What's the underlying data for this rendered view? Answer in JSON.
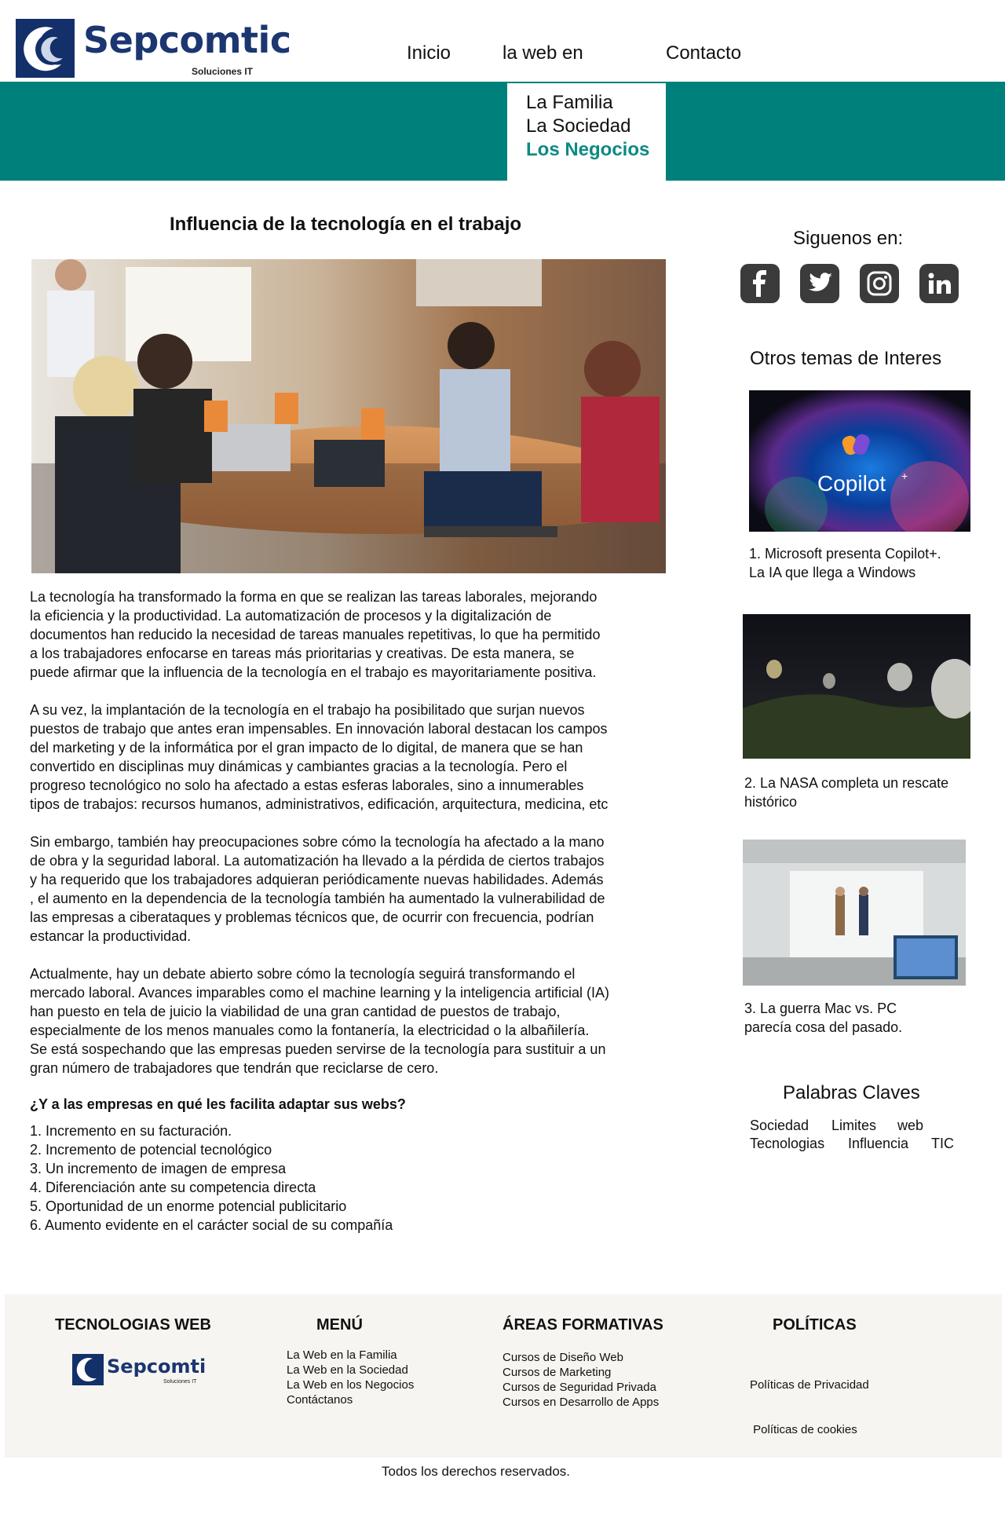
{
  "brand": {
    "name": "Sepcomtic",
    "tagline": "Soluciones IT"
  },
  "nav": {
    "inicio": "Inicio",
    "web": "la web en",
    "contacto": "Contacto"
  },
  "dropdown": [
    "La Familia",
    "La Sociedad",
    "Los Negocios"
  ],
  "article": {
    "title": "Influencia de la tecnología en el trabajo",
    "paragraphs": [
      "La tecnología ha transformado la forma en que se realizan las tareas laborales, mejorando\n la eficiencia y la productividad. La automatización de procesos y la digitalización de\ndocumentos han reducido la necesidad de tareas manuales repetitivas, lo que ha permitido\na los trabajadores enfocarse en tareas más prioritarias y creativas. De esta manera, se\npuede afirmar que la influencia de la tecnología en el trabajo es mayoritariamente positiva.",
      "A su vez, la implantación de la tecnología en el trabajo ha posibilitado que surjan nuevos\npuestos de trabajo que antes eran impensables. En innovación laboral destacan los campos\n del marketing y de la informática por el gran impacto de lo digital, de manera que se han\nconvertido en disciplinas muy dinámicas y cambiantes gracias a la tecnología. Pero el\n progreso tecnológico no solo ha afectado a estas esferas laborales, sino a innumerables\n tipos de trabajos: recursos humanos, administrativos, edificación, arquitectura, medicina, etc",
      "Sin embargo, también hay preocupaciones sobre cómo la tecnología ha afectado a la mano\nde obra y la seguridad laboral. La automatización ha llevado a la pérdida de ciertos trabajos\n y ha requerido que los trabajadores adquieran periódicamente nuevas habilidades. Además\n, el aumento en la dependencia de la tecnología también ha aumentado la vulnerabilidad de\n las empresas a ciberataques y problemas técnicos que, de ocurrir con frecuencia, podrían\nestancar la productividad.",
      "Actualmente, hay un debate abierto sobre cómo la tecnología seguirá transformando el\nmercado laboral. Avances imparables como el machine learning y la inteligencia artificial (IA)\n han puesto en tela de juicio la viabilidad de una gran cantidad de puestos de trabajo,\nespecialmente de los menos manuales como la fontanería, la electricidad o la albañilería.\nSe está sospechando que las empresas pueden servirse de la tecnología para sustituir a un\n gran número de trabajadores que tendrán que reciclarse de cero."
    ],
    "question": "¿Y a las empresas en qué les facilita adaptar sus webs?",
    "benefits": [
      "1. Incremento en su facturación.",
      "2. Incremento de potencial tecnológico",
      "3. Un incremento de imagen de empresa",
      "4. Diferenciación ante su competencia directa",
      "5. Oportunidad de un enorme potencial publicitario",
      "6. Aumento evidente en el carácter social de su compañía"
    ]
  },
  "sidebar": {
    "follow": "Siguenos en:",
    "social": [
      "facebook-icon",
      "twitter-icon",
      "instagram-icon",
      "linkedin-icon"
    ],
    "others_title": "Otros temas de Interes",
    "thumb1_text": "Copilot",
    "captions": [
      "1. Microsoft presenta Copilot+.\nLa IA que llega a Windows",
      "2. La NASA completa un rescate\n histórico",
      "3. La guerra Mac vs. PC\nparecía cosa del pasado."
    ],
    "keywords_title": "Palabras Claves",
    "keywords": [
      "Sociedad",
      "Limites",
      "web",
      "Tecnologias",
      "Influencia",
      "TIC"
    ]
  },
  "footer": {
    "col1_title": "TECNOLOGIAS WEB",
    "col2_title": "MENÚ",
    "menu": [
      "La Web en la Familia",
      "La Web en la Sociedad",
      "La Web en los Negocios",
      "Contáctanos"
    ],
    "col3_title": "ÁREAS FORMATIVAS",
    "areas": [
      "Cursos de Diseño Web",
      "Cursos de Marketing",
      "Cursos de Seguridad Privada",
      "Cursos en Desarrollo de Apps"
    ],
    "col4_title": "POLÍTICAS",
    "policies": [
      "Políticas de Privacidad",
      " Políticas de cookies"
    ],
    "copyright": "Todos los derechos reservados."
  },
  "colors": {
    "teal": "#00807b",
    "brand_blue": "#1b3670",
    "active_link": "#0b8a82"
  }
}
